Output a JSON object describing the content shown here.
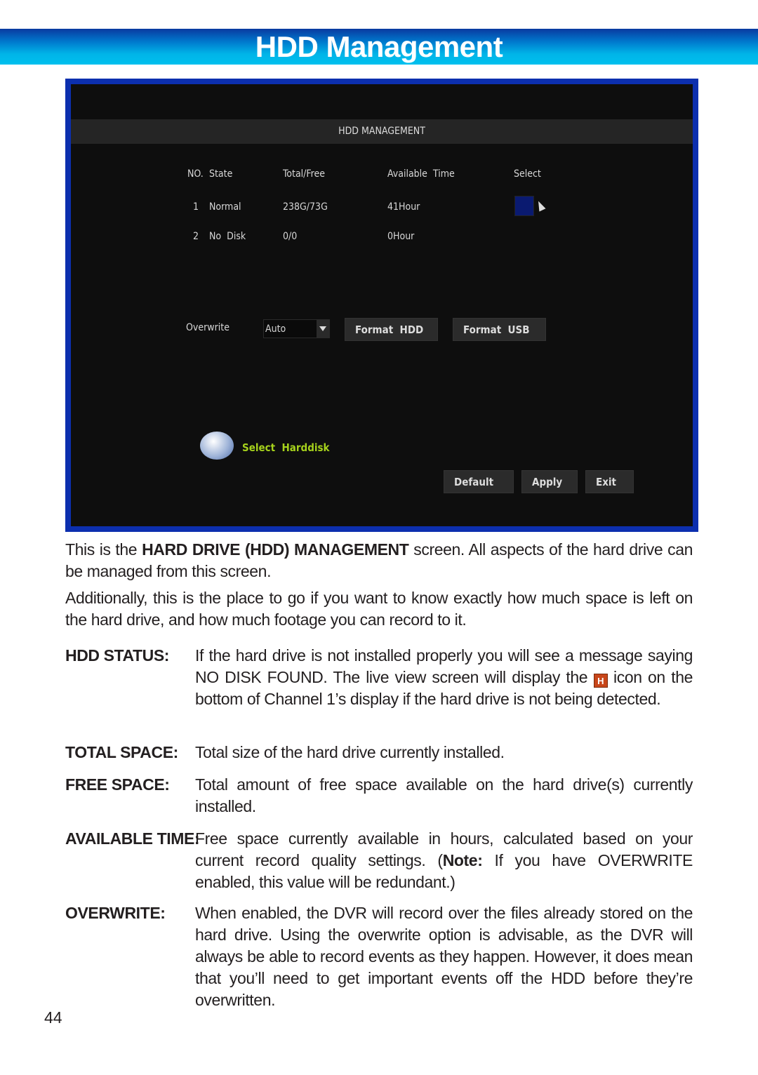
{
  "header": {
    "title": "HDD Management"
  },
  "dvr_screen": {
    "title": "HDD MANAGEMENT",
    "columns": [
      "NO.",
      "State",
      "Total/Free",
      "Available  Time",
      "Select"
    ],
    "rows": [
      {
        "no": "1",
        "state": "Normal",
        "total_free": "238G/73G",
        "available_time": "41Hour",
        "selected": true
      },
      {
        "no": "2",
        "state": "No  Disk",
        "total_free": "0/0",
        "available_time": "0Hour",
        "selected": false
      }
    ],
    "overwrite_label": "Overwrite",
    "overwrite_value": "Auto",
    "format_hdd": "Format  HDD",
    "format_usb": "Format  USB",
    "help_text": "Select  Harddisk",
    "default": "Default",
    "apply": "Apply",
    "exit": "Exit",
    "colors": {
      "frame": "#0c2fae",
      "help_text": "#a6d21c",
      "select_box": "#0a1a70"
    }
  },
  "body": {
    "p1_a": "This is the ",
    "p1_b": "HARD DRIVE (HDD) MANAGEMENT",
    "p1_c": " screen. All aspects of the hard drive can be managed from this screen.",
    "p2": "Additionally, this is the place to go if you want to know exactly how much space is left on the hard drive, and how much footage you can record to it."
  },
  "definitions": [
    {
      "label": "HDD STATUS:",
      "text_a": "If the hard drive is not installed properly you will see a message saying NO DISK FOUND. The live view screen will display the ",
      "icon": "H",
      "text_b": " icon on the bottom of Channel 1’s display if the hard drive is not being detected."
    },
    {
      "label": "TOTAL SPACE:",
      "text": "Total size of the hard drive currently installed."
    },
    {
      "label": "FREE SPACE:",
      "text": "Total amount of free space available on the hard drive(s) currently installed."
    },
    {
      "label": "AVAILABLE TIME:",
      "text_a": "Free space currently available in hours, calculated based on your current record quality settings. (",
      "note": "Note:",
      "text_b": " If you have OVERWRITE enabled, this value will be redundant.)"
    },
    {
      "label": "OVERWRITE:",
      "text": "When enabled, the DVR will record over the files already stored on the hard drive. Using the overwrite option is advisable, as the DVR will always be able to record events as they happen. However, it does mean that you’ll need to get important events off the HDD before they’re overwritten."
    }
  ],
  "page_number": "44"
}
